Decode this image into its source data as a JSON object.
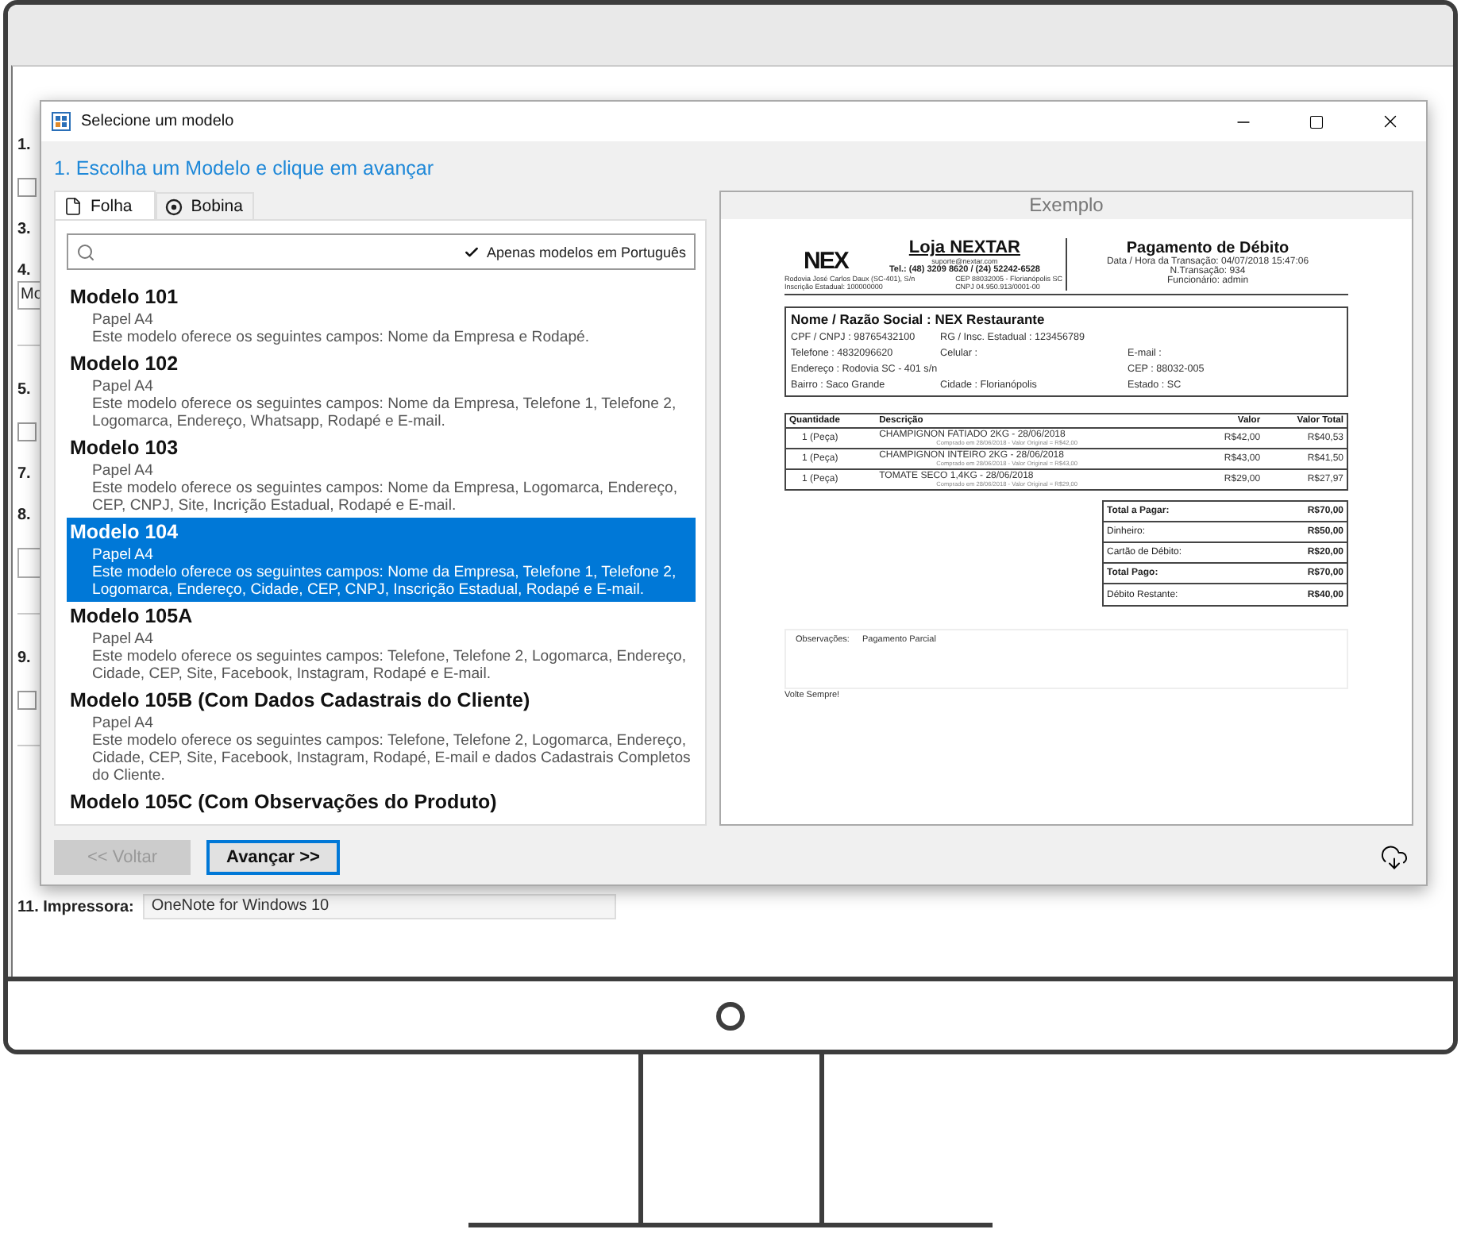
{
  "background_app": {
    "sections": [
      {
        "rows": [
          {
            "kind": "label",
            "text": "1."
          },
          {
            "kind": "checkbox",
            "checked": false
          },
          {
            "kind": "label",
            "text": "3."
          },
          {
            "kind": "label",
            "text": "4."
          },
          {
            "kind": "field",
            "value": "Mo"
          }
        ]
      },
      {
        "rows": [
          {
            "kind": "label",
            "text": "5."
          },
          {
            "kind": "checkbox",
            "checked": false
          },
          {
            "kind": "label",
            "text": "7."
          },
          {
            "kind": "label",
            "text": "8."
          },
          {
            "kind": "box"
          }
        ]
      },
      {
        "rows": [
          {
            "kind": "label",
            "text": "9."
          },
          {
            "kind": "checkbox",
            "checked": false
          }
        ]
      }
    ],
    "printer": {
      "label": "11. Impressora:",
      "value": "OneNote for Windows 10"
    }
  },
  "dialog": {
    "title": "Selecione um modelo",
    "heading": "1. Escolha um Modelo e clique em avançar",
    "tabs": [
      {
        "label": "Folha",
        "kind": "sheet",
        "selected": true
      },
      {
        "label": "Bobina",
        "kind": "roll",
        "selected": false
      }
    ],
    "filter": {
      "label": "Apenas modelos em Português",
      "checked": true
    },
    "models": [
      {
        "title": "Modelo 101",
        "paper": "Papel A4",
        "description": "Este modelo oferece os seguintes campos: Nome da Empresa e Rodapé.",
        "selected": false
      },
      {
        "title": "Modelo 102",
        "paper": "Papel A4",
        "description": "Este modelo oferece os seguintes campos: Nome da Empresa, Telefone 1, Telefone 2, Logomarca, Endereço, Whatsapp, Rodapé e E-mail.",
        "selected": false
      },
      {
        "title": "Modelo 103",
        "paper": "Papel A4",
        "description": "Este modelo oferece os seguintes campos: Nome da Empresa, Logomarca, Endereço, CEP, CNPJ, Site, Incrição Estadual, Rodapé e E-mail.",
        "selected": false
      },
      {
        "title": "Modelo 104",
        "paper": "Papel A4",
        "description": "Este modelo oferece os seguintes campos: Nome da Empresa, Telefone 1, Telefone 2, Logomarca, Endereço, Cidade, CEP, CNPJ, Inscrição Estadual, Rodapé e E-mail.",
        "selected": true
      },
      {
        "title": "Modelo 105A",
        "paper": "Papel A4",
        "description": "Este modelo oferece os seguintes campos: Telefone, Telefone 2, Logomarca, Endereço, Cidade, CEP, Site, Facebook, Instagram, Rodapé e E-mail.",
        "selected": false
      },
      {
        "title": "Modelo 105B (Com Dados Cadastrais do Cliente)",
        "paper": "Papel A4",
        "description": "Este modelo oferece os seguintes campos: Telefone, Telefone 2, Logomarca, Endereço, Cidade, CEP, Site, Facebook, Instagram, Rodapé, E-mail e dados Cadastrais Completos do Cliente.",
        "selected": false
      },
      {
        "title": "Modelo 105C (Com Observações do Produto)",
        "selected": false
      }
    ],
    "preview": {
      "title": "Exemplo",
      "receipt": {
        "logo": "NEX",
        "store": "Loja NEXTAR",
        "email": "suporte@nextar.com",
        "phone": "Tel.: (48) 3209 8620  /  (24) 52242-6528",
        "address_left": [
          "Rodovia José Carlos Daux (SC-401), S/n",
          "Inscrição Estadual: 100000000"
        ],
        "address_right": [
          "CEP 88032005 - Florianópolis SC",
          "CNPJ 04.950.913/0001-00"
        ],
        "doc_title": "Pagamento de Débito",
        "meta": [
          "Data / Hora da Transação: 04/07/2018 15:47:06",
          "N.Transação: 934",
          "Funcionário: admin"
        ],
        "customer_name": "Nome / Razão Social : NEX Restaurante",
        "customer_rows": [
          {
            "column_1": "CPF / CNPJ : 98765432100",
            "column_2": "RG / Insc. Estadual : 123456789"
          },
          {
            "column_1": "Telefone : 4832096620",
            "column_2": "Celular :",
            "column_3": "E-mail :"
          },
          {
            "column_1": "Endereço : Rodovia SC - 401 s/n",
            "column_3": "CEP : 88032-005"
          },
          {
            "column_1": "Bairro : Saco Grande",
            "column_2": "Cidade : Florianópolis",
            "column_3": "Estado : SC"
          }
        ],
        "columns": [
          "Quantidade",
          "Descrição",
          "Valor",
          "Valor Total"
        ],
        "items": [
          {
            "quantity": "1 (Peça)",
            "description": "CHAMPIGNON FATIADO 2KG - 28/06/2018",
            "note": "Comprado em 28/06/2018 - Valor Original = R$42,00",
            "price": "R$42,00",
            "total": "R$40,53"
          },
          {
            "quantity": "1 (Peça)",
            "description": "CHAMPIGNON INTEIRO 2KG - 28/06/2018",
            "note": "Comprado em 28/06/2018 - Valor Original = R$43,00",
            "price": "R$43,00",
            "total": "R$41,50"
          },
          {
            "quantity": "1 (Peça)",
            "description": "TOMATE SECO 1,4KG - 28/06/2018",
            "note": "Comprado em 28/06/2018 - Valor Original = R$29,00",
            "price": "R$29,00",
            "total": "R$27,97"
          }
        ],
        "totals": [
          {
            "label": "Total a Pagar:",
            "value": "R$70,00",
            "emphasis": true
          },
          {
            "label": "Dinheiro:",
            "value": "R$50,00",
            "emphasis": false
          },
          {
            "label": "Cartão de Débito:",
            "value": "R$20,00",
            "emphasis": false
          },
          {
            "label": "Total Pago:",
            "value": "R$70,00",
            "emphasis": true
          },
          {
            "label": "Débito Restante:",
            "value": "R$40,00",
            "emphasis": false
          }
        ],
        "notes_label": "Observações:",
        "notes": "Pagamento Parcial",
        "footer": "Volte Sempre!"
      }
    },
    "buttons": [
      {
        "label": "<< Voltar",
        "disabled": true
      },
      {
        "label": "Avançar >>",
        "disabled": false
      }
    ]
  }
}
